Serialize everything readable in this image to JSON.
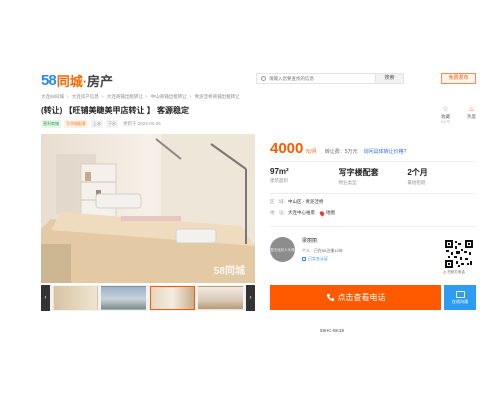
{
  "header": {
    "logo_58": "58",
    "logo_text": "同城·",
    "logo_sub": "房产",
    "search_placeholder": "请输入您要查找的信息",
    "search_button": "搜索",
    "post_button": "免费发布"
  },
  "breadcrumb": [
    "大连58同城",
    "大连房产信息",
    "大连商铺出租转让",
    "中山商铺出租转让",
    "青泥洼桥商铺出租转让"
  ],
  "listing": {
    "title": "(转让) 【旺铺美睫美甲店转让 】 客源稳定",
    "tags": [
      {
        "label": "营利商铺",
        "style": "green"
      },
      {
        "label": "写字楼配套",
        "style": "orange"
      },
      {
        "label": "上水",
        "style": "gray"
      },
      {
        "label": "下水",
        "style": "gray"
      }
    ],
    "updated": "更新于 2024-04-25",
    "favorite_label": "收藏",
    "hot_label": "热度",
    "views": "0人气",
    "watermark": "58同城"
  },
  "gallery": {
    "prev": "‹",
    "next": "›",
    "thumb_count": 4,
    "active_thumb": 2
  },
  "price": {
    "amount": "4000",
    "unit": "元/月",
    "transfer": "转让费：5万元",
    "ask_link": "询问具体转让价格?"
  },
  "stats": [
    {
      "value": "97m²",
      "label": "建筑面积"
    },
    {
      "value": "写字楼配套",
      "label": "物业类型"
    },
    {
      "value": "2个月",
      "label": "最短租期"
    }
  ],
  "location": {
    "area_label": "区　域：",
    "area_value": "中山区 - 青泥洼桥",
    "addr_label": "地　址：",
    "addr_value": "大连中心裕景",
    "map_link": "地图"
  },
  "agent": {
    "avatar_text": "暂无经纪人头像",
    "name": "梁丽丽",
    "meta": "个人　已在58注册10年",
    "cert": "已实名认证",
    "qr_label": "扫码打电话"
  },
  "actions": {
    "call": "点击查看电话",
    "chat": "在线沟通"
  },
  "ref_code": "58HC-BK38"
}
